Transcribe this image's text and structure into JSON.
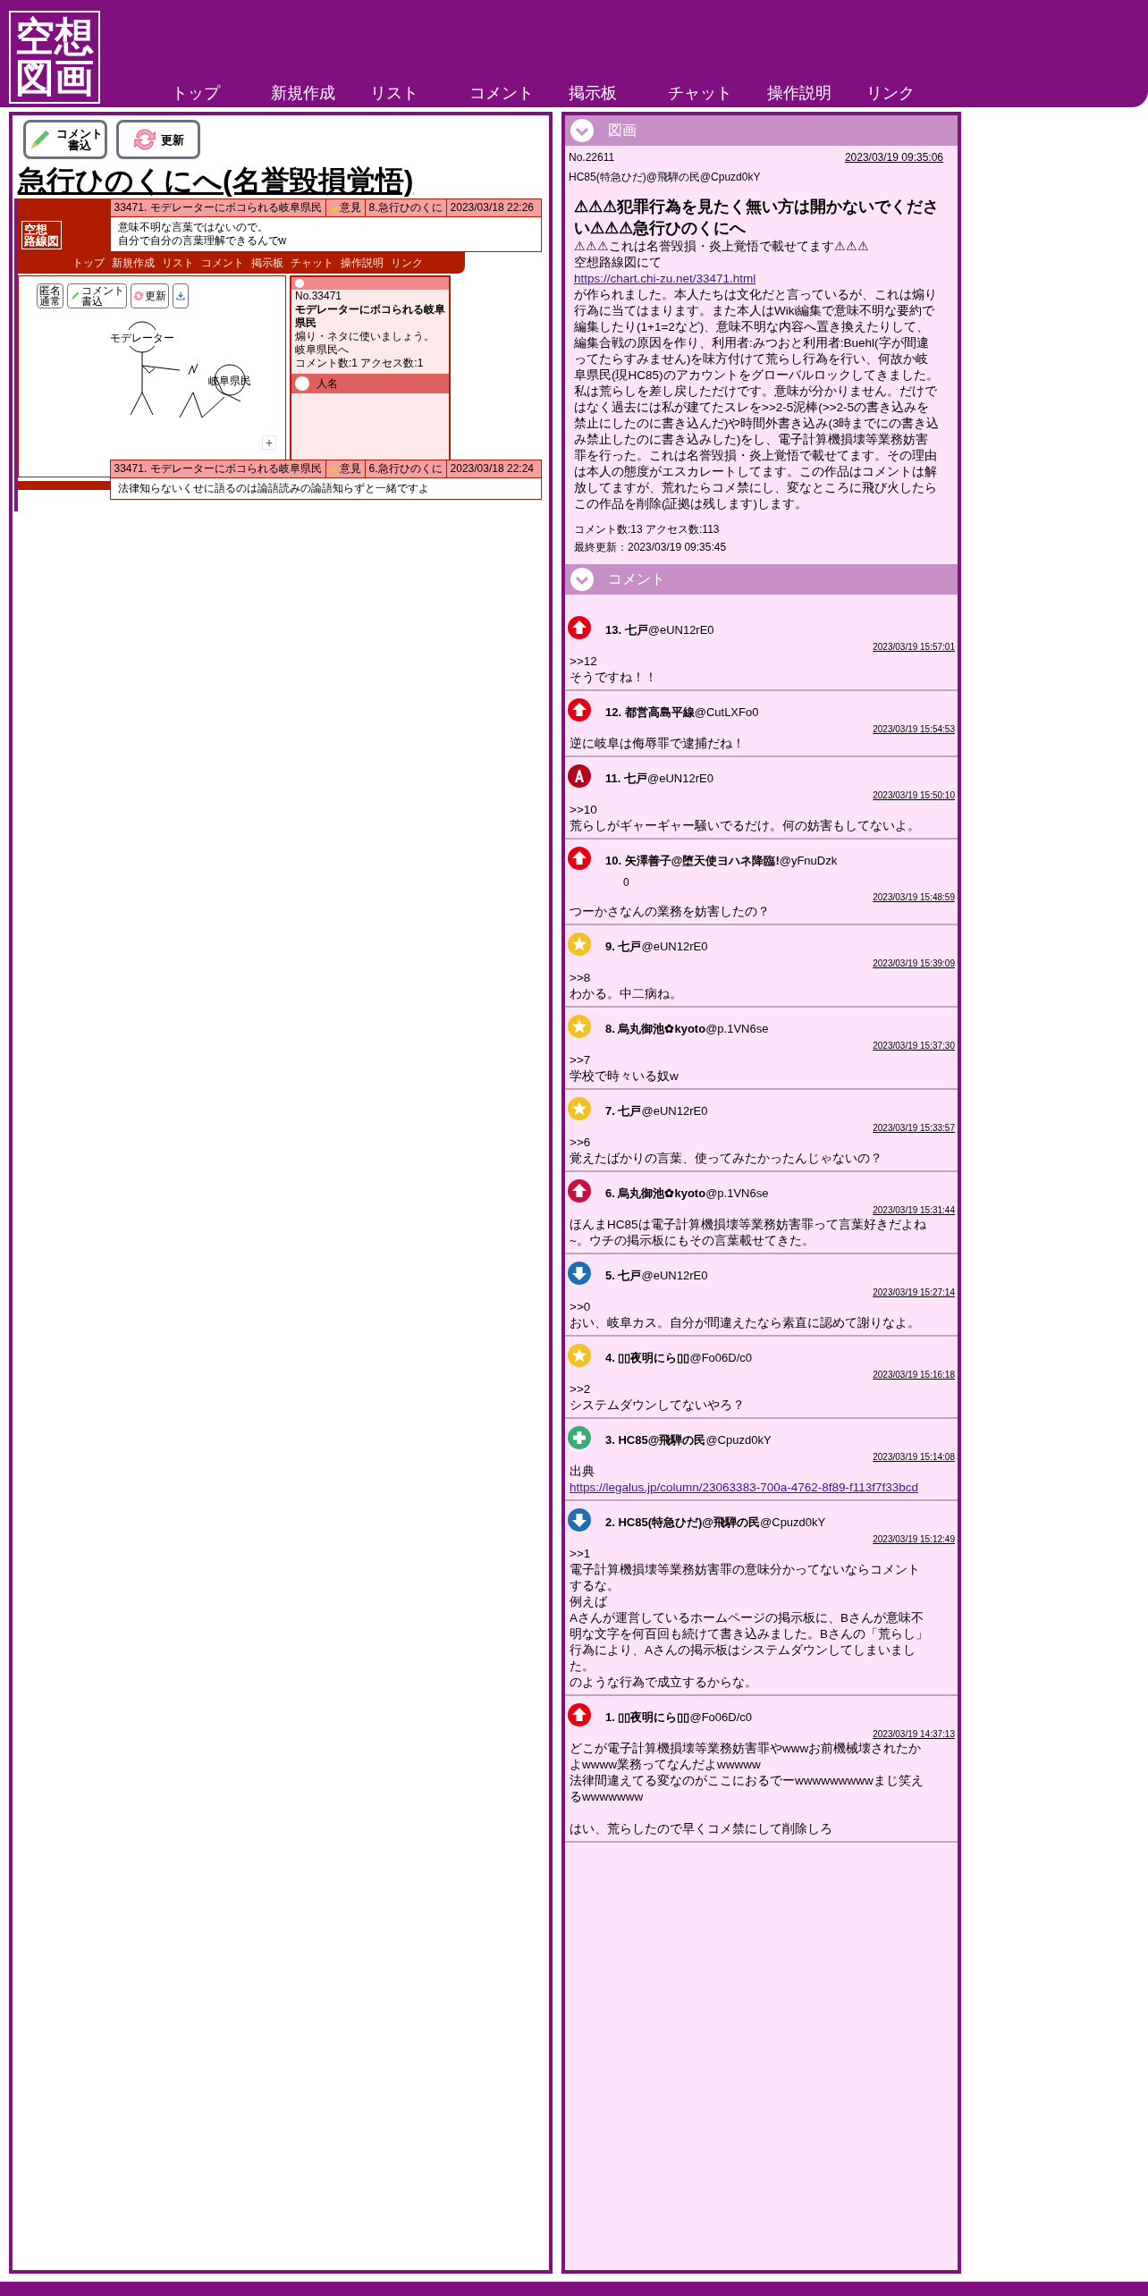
{
  "header": {
    "logo": [
      "空想",
      "図画"
    ],
    "nav": [
      {
        "label": "トップ"
      },
      {
        "label": "新規作成"
      },
      {
        "label": "リスト"
      },
      {
        "label": "コメント"
      },
      {
        "label": "掲示板"
      },
      {
        "label": "チャット"
      },
      {
        "label": "操作説明"
      },
      {
        "label": "リンク"
      }
    ]
  },
  "left": {
    "buttons": [
      {
        "kind": "comment",
        "lines": [
          "コメント",
          "書込"
        ]
      },
      {
        "kind": "refresh",
        "lines": [
          "更新"
        ]
      }
    ],
    "title": "急行ひのくにへ(名誉毀損覚悟)",
    "screenshot": {
      "logo": [
        "空想",
        "路線図"
      ],
      "nav": [
        "トップ",
        "新規作成",
        "リスト",
        "コメント",
        "掲示板",
        "チャット",
        "操作説明",
        "リンク"
      ],
      "top_popup": {
        "title": "33471. モデレーターにボコられる岐阜県民",
        "tag": "意見",
        "author": "8.急行ひのくに",
        "date": "2023/03/18 22:26",
        "lines": [
          "意味不明な言葉ではないので。",
          "自分で自分の言葉理解できるんでw"
        ]
      },
      "tools": [
        {
          "kind": "mode",
          "lines": [
            "匿名",
            "通常"
          ]
        },
        {
          "kind": "comment",
          "lines": [
            "コメント",
            "書込"
          ]
        },
        {
          "kind": "refresh",
          "lines": [
            "更新"
          ]
        },
        {
          "kind": "download"
        }
      ],
      "figure_labels": [
        "モデレーター",
        "岐阜県民"
      ],
      "plus": "+",
      "side": {
        "no": "No.33471",
        "title": "モデレーターにボコられる岐阜県民",
        "lines": [
          "煽り・ネタに使いましょう。",
          "岐阜県民へ"
        ],
        "stats": "コメント数:1 アクセス数:1",
        "user": "人名"
      },
      "bottom_popup": {
        "title": "33471. モデレーターにボコられる岐阜県民",
        "tag": "意見",
        "author": "6.急行ひのくに",
        "date": "2023/03/18 22:24",
        "lines": [
          "法律知らないくせに語るのは論語読みの論語知らずと一緒ですよ"
        ]
      }
    }
  },
  "drawing": {
    "section": "図画",
    "no": "No.22611",
    "date": "2023/03/19 09:35:06",
    "author": "HC85(特急ひだ)@飛騨の民@Cpuzd0kY",
    "title": "⚠⚠⚠犯罪行為を見たく無い方は開かないでください⚠⚠⚠急行ひのくにへ",
    "intro": [
      "⚠⚠⚠これは名誉毀損・炎上覚悟で載せてます⚠⚠⚠",
      "空想路線図にて"
    ],
    "link": "https://chart.chi-zu.net/33471.html",
    "body": "が作られました。本人たちは文化だと言っているが、これは煽り行為に当てはまります。また本人はWiki編集で意味不明な要約で編集したり(1+1=2など)、意味不明な内容へ置き換えたりして、編集合戦の原因を作り、利用者:みつおと利用者:Buehl(字が間違ってたらすみません)を味方付けて荒らし行為を行い、何故か岐阜県民(現HC85)のアカウントをグローバルロックしてきました。私は荒らしを差し戻しただけです。意味が分かりません。だけではなく過去には私が建てたスレを>>2-5泥棒(>>2-5の書き込みを禁止にしたのに書き込んだ)や時間外書き込み(3時までにの書き込み禁止したのに書き込みした)をし、電子計算機損壊等業務妨害罪を行った。これは名誉毀損・炎上覚悟で載せてます。その理由は本人の態度がエスカレートしてます。この作品はコメントは解放してますが、荒れたらコメ禁にし、変なところに飛び火したらこの作品を削除(証拠は残します)します。",
    "stats": "コメント数:13 アクセス数:113",
    "updated": "最終更新：2023/03/19 09:35:45"
  },
  "comments_section": "コメント",
  "comments": [
    {
      "num": "13.",
      "name": "七戸",
      "id": "@eUN12rE0",
      "date": "2023/03/19 15:57:01",
      "body": [
        [
          ">>12",
          "そうですね！！"
        ]
      ],
      "icon": {
        "kind": "up",
        "color": "#e60012"
      }
    },
    {
      "num": "12.",
      "name": "都営高島平線",
      "id": "@CutLXFo0",
      "date": "2023/03/19 15:54:53",
      "body": [
        [
          "逆に岐阜は侮辱罪で逮捕だね！"
        ]
      ],
      "icon": {
        "kind": "up",
        "color": "#e60012"
      }
    },
    {
      "num": "11.",
      "name": "七戸",
      "id": "@eUN12rE0",
      "date": "2023/03/19 15:50:10",
      "body": [
        [
          ">>10",
          "荒らしがギャーギャー騒いでるだけ。何の妨害もしてないよ。"
        ]
      ],
      "icon": {
        "kind": "letter",
        "color": "#b5001b"
      }
    },
    {
      "num": "10.",
      "name": "矢澤善子@堕天使ヨハネ降臨!",
      "id": "@yFnuDzk",
      "note": "0",
      "date": "2023/03/19 15:48:59",
      "body": [
        [
          "つーかさなんの業務を妨害したの？"
        ]
      ],
      "icon": {
        "kind": "up",
        "color": "#e60012"
      }
    },
    {
      "num": "9.",
      "name": "七戸",
      "id": "@eUN12rE0",
      "date": "2023/03/19 15:39:09",
      "body": [
        [
          ">>8",
          "わかる。中二病ね。"
        ]
      ],
      "icon": {
        "kind": "star",
        "color": "#f5c023"
      }
    },
    {
      "num": "8.",
      "name": "烏丸御池✿kyoto",
      "id": "@p.1VN6se",
      "date": "2023/03/19 15:37:30",
      "body": [
        [
          ">>7",
          "学校で時々いる奴w"
        ]
      ],
      "icon": {
        "kind": "star",
        "color": "#f5c023"
      }
    },
    {
      "num": "7.",
      "name": "七戸",
      "id": "@eUN12rE0",
      "date": "2023/03/19 15:33:57",
      "body": [
        [
          ">>6",
          "覚えたばかりの言葉、使ってみたかったんじゃないの？"
        ]
      ],
      "icon": {
        "kind": "star",
        "color": "#f5c023"
      }
    },
    {
      "num": "6.",
      "name": "烏丸御池✿kyoto",
      "id": "@p.1VN6se",
      "date": "2023/03/19 15:31:44",
      "body": [
        [
          "ほんまHC85は電子計算機損壊等業務妨害罪って言葉好きだよね~。ウチの掲示板にもその言葉載せてきた。"
        ]
      ],
      "icon": {
        "kind": "up",
        "color": "#c8103c"
      }
    },
    {
      "num": "5.",
      "name": "七戸",
      "id": "@eUN12rE0",
      "date": "2023/03/19 15:27:14",
      "body": [
        [
          ">>0",
          "おい、岐阜カス。自分が間違えたなら素直に認めて謝りなよ。"
        ]
      ],
      "icon": {
        "kind": "down",
        "color": "#1f6fb5"
      }
    },
    {
      "num": "4.",
      "name": "▯▯夜明にら▯▯",
      "id": "@Fo06D/c0",
      "date": "2023/03/19 15:16:18",
      "body": [
        [
          ">>2",
          "システムダウンしてないやろ？"
        ]
      ],
      "icon": {
        "kind": "star",
        "color": "#f5c023"
      }
    },
    {
      "num": "3.",
      "name": "HC85@飛騨の民",
      "id": "@Cpuzd0kY",
      "date": "2023/03/19 15:14:08",
      "body": [
        [
          "出典"
        ]
      ],
      "link": "https://legalus.jp/column/23063383-700a-4762-8f89-f113f7f33bcd",
      "icon": {
        "kind": "plus",
        "color": "#3aaa76"
      }
    },
    {
      "num": "2.",
      "name": "HC85(特急ひだ)@飛騨の民",
      "id": "@Cpuzd0kY",
      "date": "2023/03/19 15:12:49",
      "body": [
        [
          ">>1",
          "電子計算機損壊等業務妨害罪の意味分かってないならコメントするな。",
          "例えば",
          "Aさんが運営しているホームページの掲示板に、Bさんが意味不明な文字を何百回も続けて書き込みました。Bさんの「荒らし」行為により、Aさんの掲示板はシステムダウンしてしまいました。",
          "のような行為で成立するからな。"
        ]
      ],
      "icon": {
        "kind": "down",
        "color": "#1f6fb5"
      }
    },
    {
      "num": "1.",
      "name": "▯▯夜明にら▯▯",
      "id": "@Fo06D/c0",
      "date": "2023/03/19 14:37:13",
      "body": [
        [
          "どこが電子計算機損壊等業務妨害罪やwwwお前機械壊されたかよwwww業務ってなんだよwwwww",
          "法律間違えてる変なのがここにおるでーwwwwwwwwwまじ笑えるwwwwwww"
        ],
        [
          "はい、荒らしたので早くコメ禁にして削除しろ"
        ]
      ],
      "icon": {
        "kind": "up",
        "color": "#e60012"
      }
    }
  ]
}
